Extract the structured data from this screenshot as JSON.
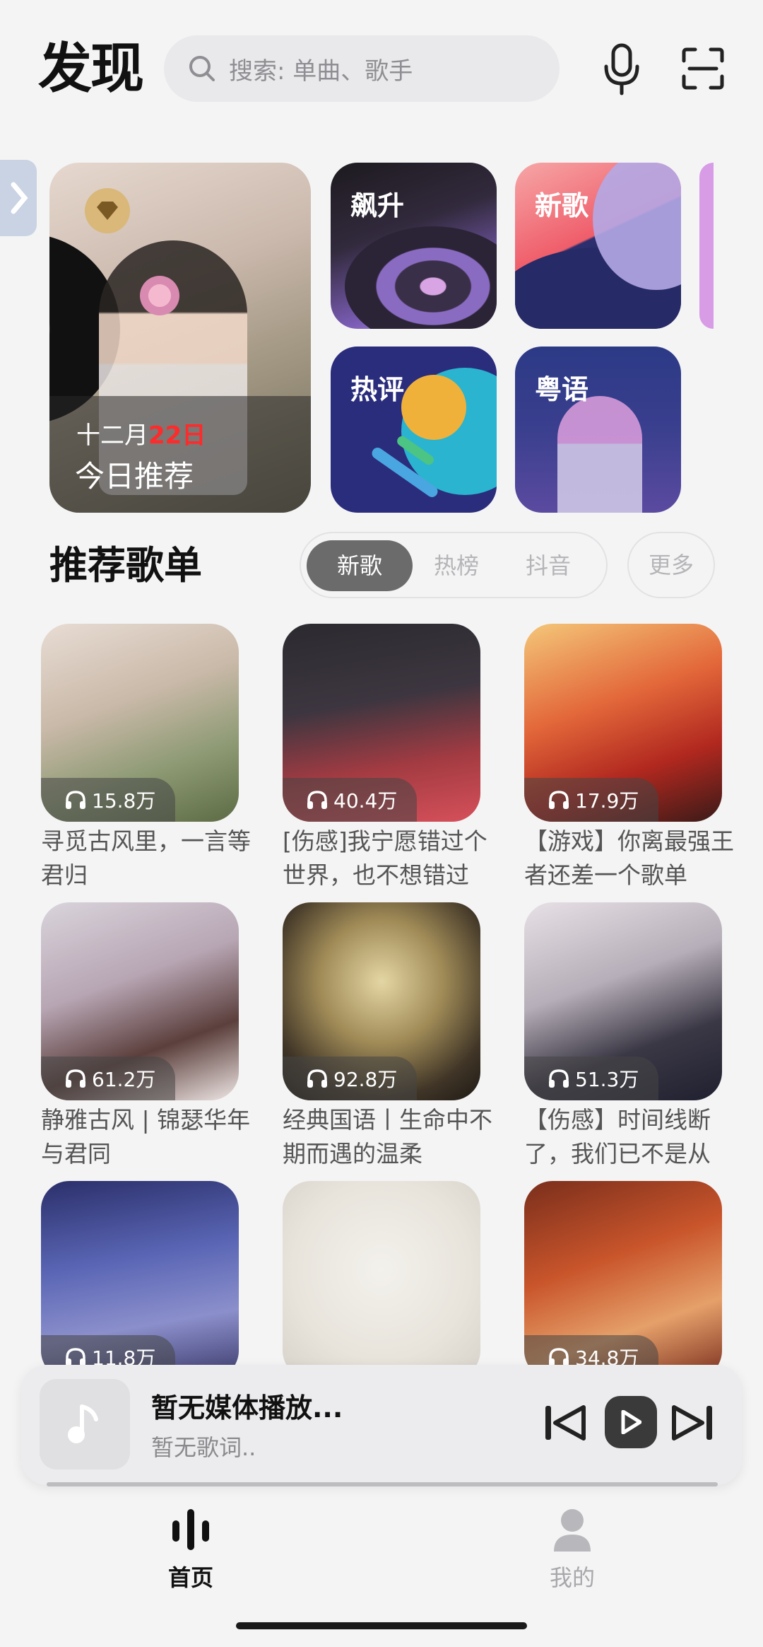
{
  "header": {
    "title": "发现",
    "search_placeholder": "搜索: 单曲、歌手"
  },
  "featured": {
    "daily": {
      "month": "十二月",
      "day": "22日",
      "label": "今日推荐"
    },
    "tiles": [
      {
        "label": "飙升"
      },
      {
        "label": "新歌"
      },
      {
        "label": "热评"
      },
      {
        "label": "粤语"
      }
    ]
  },
  "section": {
    "title": "推荐歌单",
    "tabs": [
      "新歌",
      "热榜",
      "抖音"
    ],
    "active_tab": "新歌",
    "more": "更多"
  },
  "playlists": [
    {
      "count": "15.8万",
      "name": "寻觅古风里，一言等君归"
    },
    {
      "count": "40.4万",
      "name": "[伤感]我宁愿错过个世界，也不想错过"
    },
    {
      "count": "17.9万",
      "name": "【游戏】你离最强王者还差一个歌单"
    },
    {
      "count": "61.2万",
      "name": "静雅古风 | 锦瑟华年与君同"
    },
    {
      "count": "92.8万",
      "name": "经典国语丨生命中不期而遇的温柔"
    },
    {
      "count": "51.3万",
      "name": "【伤感】时间线断了，我们已不是从"
    },
    {
      "count": "11.8万",
      "name": ""
    },
    {
      "count": "",
      "name": ""
    },
    {
      "count": "34.8万",
      "name": ""
    }
  ],
  "player": {
    "title": "暂无媒体播放...",
    "lyric": "暂无歌词.."
  },
  "nav": {
    "home": "首页",
    "mine": "我的"
  },
  "colors": {
    "highlight_day": "#ff2a2a",
    "active_tab_bg": "#6b6b6b"
  }
}
